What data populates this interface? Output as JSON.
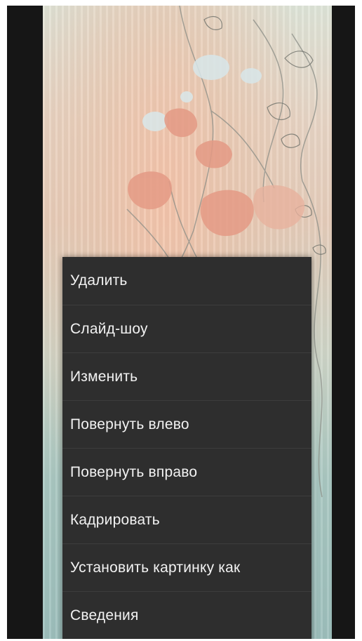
{
  "context_menu": {
    "items": [
      {
        "label": "Удалить"
      },
      {
        "label": "Слайд-шоу"
      },
      {
        "label": "Изменить"
      },
      {
        "label": "Повернуть влево"
      },
      {
        "label": "Повернуть вправо"
      },
      {
        "label": "Кадрировать"
      },
      {
        "label": "Установить картинку как"
      },
      {
        "label": "Сведения"
      }
    ]
  },
  "colors": {
    "menu_background": "#2e2e2e",
    "menu_divider": "#3d3d3d",
    "menu_text": "#f2f2f2",
    "screen_background": "#161616"
  }
}
